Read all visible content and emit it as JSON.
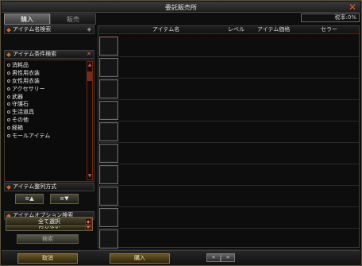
{
  "window": {
    "title": "委託販売所"
  },
  "tabs": {
    "buy": "購入",
    "sell": "販売"
  },
  "fee": "税率:0%",
  "left": {
    "name_search": "アイテム名検索",
    "cond_search": "アイテム条件検索",
    "categories": [
      "消耗品",
      "男性用衣装",
      "女性用衣装",
      "アクセサリー",
      "武器",
      "守護石",
      "生活道具",
      "その他",
      "経箱",
      "モールアイテム"
    ],
    "sort": "アイテム整列方式",
    "sort_up_label": "",
    "sort_down_label": "",
    "option_search": "アイテムオプション検索",
    "option_value": "何もない",
    "select_all": "全て選択",
    "search_button": "検索"
  },
  "table": {
    "col_name": "アイテム名",
    "col_level": "レベル",
    "col_price": "アイテム価格",
    "col_seller": "セラー",
    "rows": 10
  },
  "bottom": {
    "cancel": "取消",
    "buy": "購入",
    "prev": "«",
    "next": "»"
  }
}
